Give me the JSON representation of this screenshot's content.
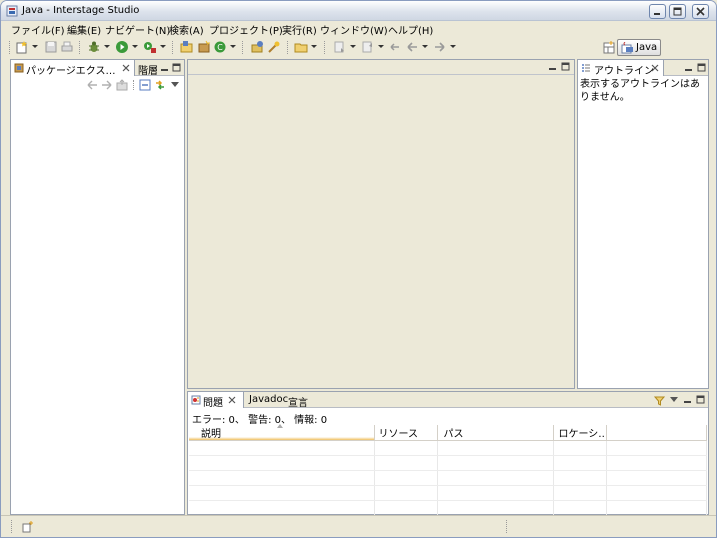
{
  "window": {
    "title": "Java - Interstage Studio"
  },
  "menu": [
    {
      "label": "ファイル(F)"
    },
    {
      "label": "編集(E)"
    },
    {
      "label": "ナビゲート(N)"
    },
    {
      "label": "検索(A)"
    },
    {
      "label": "プロジェクト(P)"
    },
    {
      "label": "実行(R)"
    },
    {
      "label": "ウィンドウ(W)"
    },
    {
      "label": "ヘルプ(H)"
    }
  ],
  "perspective": {
    "label": "Java"
  },
  "package_explorer": {
    "tab_label": "パッケージエクス…",
    "second_tab_label": "階層"
  },
  "outline": {
    "tab_label": "アウトライン",
    "message": "表示するアウトラインはありません。"
  },
  "problems": {
    "tab_label": "問題",
    "javadoc_tab_label": "Javadoc",
    "declaration_tab_label": "宣言",
    "summary": "エラー: 0、 警告: 0、 情報: 0",
    "columns": [
      "説明",
      "リソース",
      "パス",
      "ロケーシ…"
    ]
  },
  "colors": {
    "accent": "#316ac5",
    "titlebar": "#dde3ec"
  },
  "icons": [
    "app-icon",
    "new-icon",
    "save-icon",
    "print-icon",
    "debug-icon",
    "run-icon",
    "external-tools-icon",
    "new-java-project-icon",
    "new-package-icon",
    "new-class-icon",
    "open-type-icon",
    "search-icon",
    "open-folder-icon",
    "next-annotation-icon",
    "previous-annotation-icon",
    "last-edit-location-icon",
    "back-icon",
    "forward-icon",
    "open-perspective-icon",
    "java-perspective-icon"
  ]
}
